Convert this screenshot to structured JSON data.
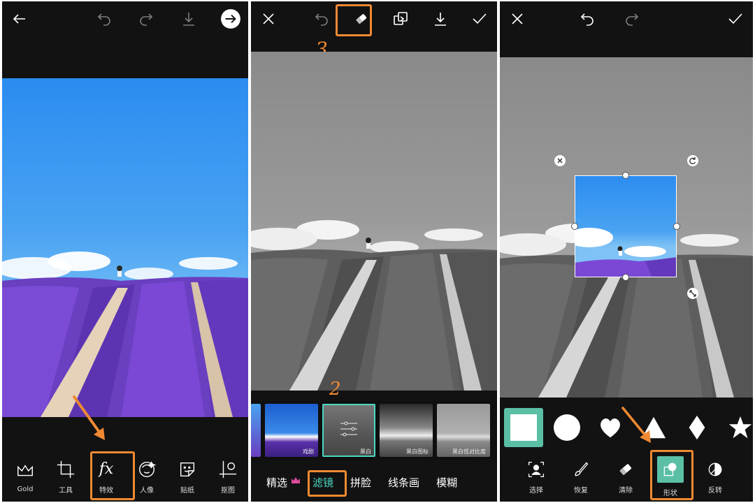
{
  "panel1": {
    "topbar": {
      "back": "arrow-left-icon",
      "undo": "undo-icon",
      "redo": "redo-icon",
      "download": "download-icon",
      "next": "arrow-right-circle-icon"
    },
    "tools": [
      {
        "icon": "crown-icon",
        "label": "Gold"
      },
      {
        "icon": "crop-icon",
        "label": "工具"
      },
      {
        "icon": "fx-icon",
        "glyph": "fx",
        "label": "特效"
      },
      {
        "icon": "portrait-icon",
        "label": "人像"
      },
      {
        "icon": "sticker-icon",
        "label": "贴纸"
      },
      {
        "icon": "cutout-icon",
        "label": "抠图"
      }
    ]
  },
  "panel2": {
    "topbar": {
      "close": "close-icon",
      "undo": "undo-icon",
      "eraser": "eraser-icon",
      "compare": "compare-icon",
      "download": "download-icon",
      "apply": "check-icon"
    },
    "annotation_3": "3",
    "annotation_2": "2",
    "filters": [
      {
        "label": ""
      },
      {
        "label": "戏剧"
      },
      {
        "label": "黑白",
        "selected": true
      },
      {
        "label": "黑白图标"
      },
      {
        "label": "黑白低对比度"
      }
    ],
    "tabs": [
      {
        "label": "精选"
      },
      {
        "label": "滤镜",
        "active": true
      },
      {
        "label": "拼脸"
      },
      {
        "label": "线条画"
      },
      {
        "label": "模糊"
      }
    ]
  },
  "panel3": {
    "topbar": {
      "close": "close-icon",
      "undo": "undo-icon",
      "redo": "redo-icon",
      "apply": "check-icon"
    },
    "shapes": [
      "square",
      "circle",
      "heart",
      "triangle",
      "diamond",
      "star"
    ],
    "tools": [
      {
        "icon": "select-person-icon",
        "label": "选择"
      },
      {
        "icon": "brush-icon",
        "label": "恢复"
      },
      {
        "icon": "eraser-icon",
        "label": "清除"
      },
      {
        "icon": "shape-icon",
        "label": "形状"
      },
      {
        "icon": "invert-icon",
        "label": "反转"
      }
    ]
  },
  "colors": {
    "highlight": "#f08a32",
    "accent": "#4ad8c0",
    "teal_tile": "#5bbfa6"
  }
}
